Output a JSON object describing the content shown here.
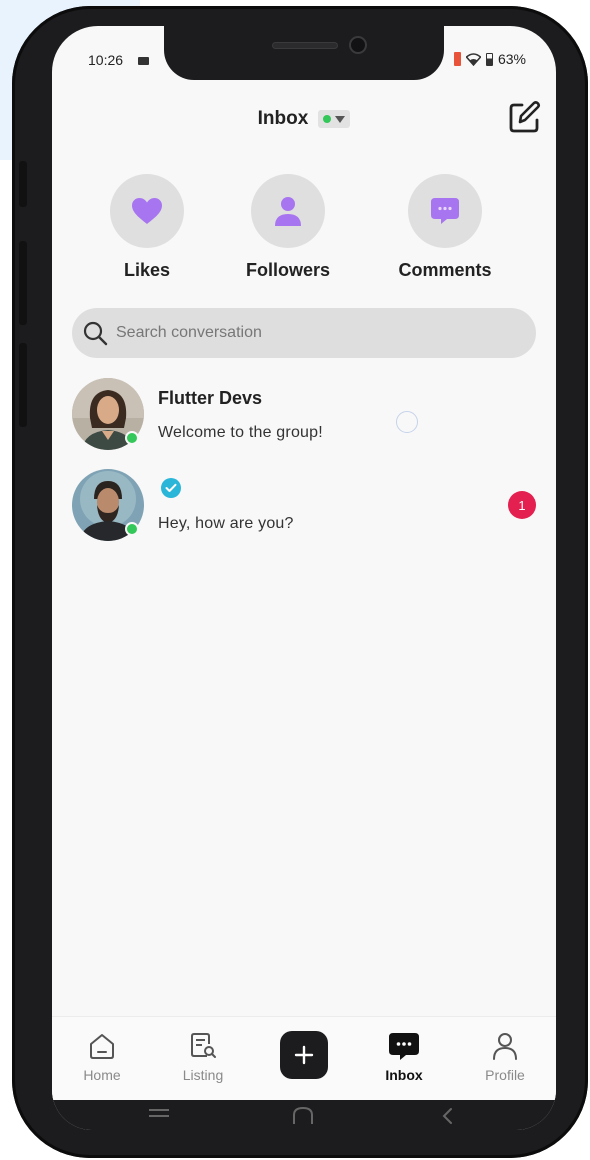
{
  "status_bar": {
    "time": "10:26",
    "battery": "63%"
  },
  "header": {
    "title": "Inbox"
  },
  "activity": [
    {
      "label": "Likes",
      "icon": "heart-icon"
    },
    {
      "label": "Followers",
      "icon": "person-icon"
    },
    {
      "label": "Comments",
      "icon": "comment-icon"
    }
  ],
  "search": {
    "placeholder": "Search conversation"
  },
  "conversations": [
    {
      "name": "Flutter Devs",
      "message": "Welcome to the group!"
    },
    {
      "name": "",
      "message": "Hey, how are you?",
      "verified": true,
      "unread": "1"
    }
  ],
  "tabs": [
    {
      "label": "Home",
      "icon": "home-icon"
    },
    {
      "label": "Listing",
      "icon": "listing-icon"
    },
    {
      "label": "",
      "icon": "plus-icon"
    },
    {
      "label": "Inbox",
      "icon": "inbox-icon",
      "active": true
    },
    {
      "label": "Profile",
      "icon": "profile-icon"
    }
  ],
  "colors": {
    "accent_purple": "#a875f0",
    "online_green": "#34c759",
    "badge_red": "#e3204f",
    "verified_blue": "#29b6d8"
  }
}
